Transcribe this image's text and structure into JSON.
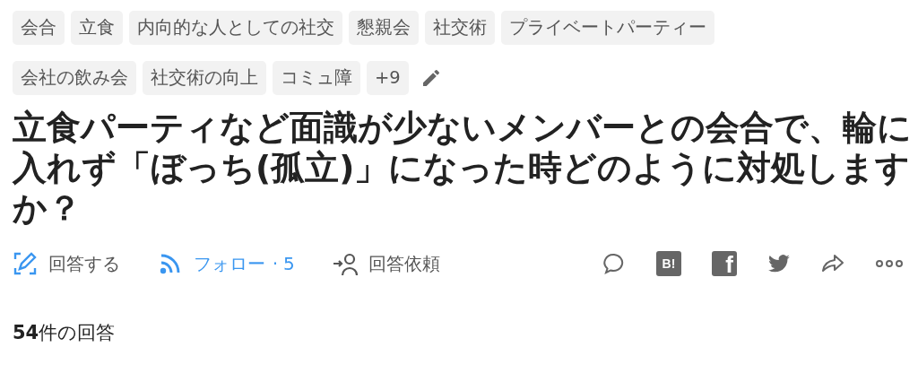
{
  "tags": [
    {
      "label": "会合"
    },
    {
      "label": "立食"
    },
    {
      "label": "内向的な人としての社交"
    },
    {
      "label": "懇親会"
    },
    {
      "label": "社交術"
    },
    {
      "label": "プライベートパーティー"
    },
    {
      "label": "会社の飲み会"
    },
    {
      "label": "社交術の向上"
    },
    {
      "label": "コミュ障"
    },
    {
      "label": "+9"
    }
  ],
  "title": "立食パーティなど面識が少ないメンバーとの会合で、輪に入れず「ぼっち(孤立)」になった時どのように対処しますか？",
  "actions": [
    {
      "kind": "answer",
      "label": "回答する"
    },
    {
      "kind": "follow",
      "label": "フォロー",
      "separator": "·",
      "count": "5"
    },
    {
      "kind": "request",
      "label": "回答依頼"
    }
  ],
  "share": [
    {
      "kind": "comment"
    },
    {
      "kind": "hatena",
      "label": "B!"
    },
    {
      "kind": "facebook",
      "label": "f"
    },
    {
      "kind": "twitter"
    },
    {
      "kind": "forward"
    },
    {
      "kind": "more"
    }
  ],
  "answers_heading": "**54**件の回答"
}
